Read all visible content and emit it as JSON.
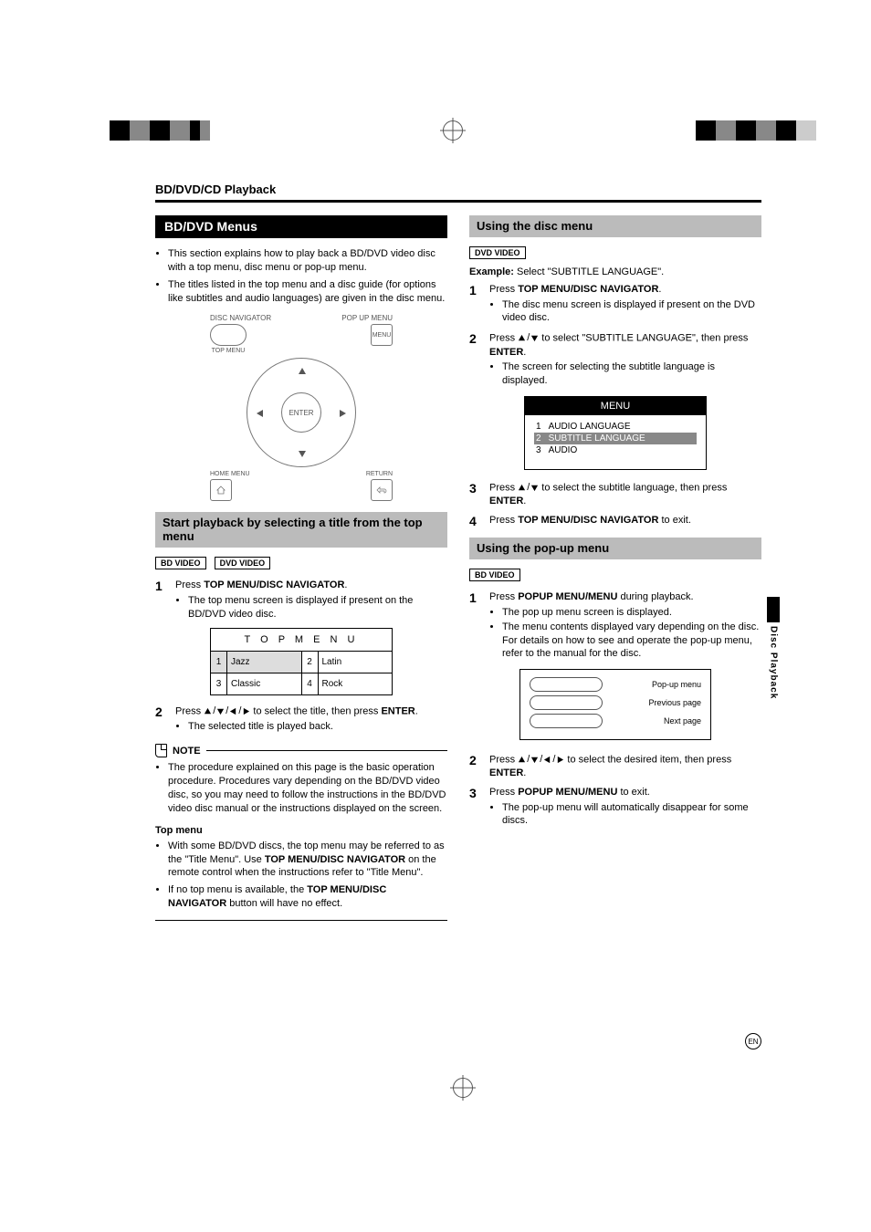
{
  "header": {
    "breadcrumb": "BD/DVD/CD Playback"
  },
  "left": {
    "section_title": "BD/DVD Menus",
    "intro_bullets": [
      "This section explains how to play back a BD/DVD video disc with a top menu, disc menu or pop-up menu.",
      "The titles listed in the top menu and a disc guide (for options like subtitles and audio languages) are given in the disc menu."
    ],
    "remote": {
      "disc_nav": "DISC NAVIGATOR",
      "popup_menu": "POP UP MENU",
      "top_menu": "TOP MENU",
      "menu": "MENU",
      "home_menu": "HOME MENU",
      "return": "RETURN",
      "enter": "ENTER"
    },
    "subhead": "Start playback by selecting a title from the top menu",
    "badges": [
      "BD VIDEO",
      "DVD VIDEO"
    ],
    "steps": [
      {
        "n": "1",
        "line": "Press ",
        "bold": "TOP MENU/DISC NAVIGATOR",
        "tail": ".",
        "sub": [
          "The top menu screen is displayed if present on the BD/DVD video disc."
        ]
      },
      {
        "n": "2",
        "prefix": "Press ",
        "mid": " to select the title, then press ",
        "bold": "ENTER",
        "tail": ".",
        "sub": [
          "The selected title is played back."
        ]
      }
    ],
    "top_menu": {
      "title": "T O P  M E N U",
      "rows": [
        {
          "n1": "1",
          "l1": "Jazz",
          "n2": "2",
          "l2": "Latin"
        },
        {
          "n1": "3",
          "l1": "Classic",
          "n2": "4",
          "l2": "Rock"
        }
      ]
    },
    "note": {
      "label": "NOTE",
      "bullets": [
        "The procedure explained on this page is the basic operation procedure. Procedures vary depending on the BD/DVD video disc, so you may need to follow the instructions in the BD/DVD video disc manual or the instructions displayed on the screen."
      ]
    },
    "top_menu_section": {
      "title": "Top menu",
      "bullets": [
        {
          "pre": "With some BD/DVD discs, the top menu may be referred to as the \"Title Menu\". Use ",
          "bold": "TOP MENU/DISC NAVIGATOR",
          "post": " on the remote control when the instructions refer to \"Title Menu\"."
        },
        {
          "pre": "If no top menu is available, the ",
          "bold": "TOP MENU/DISC NAVIGATOR",
          "post": " button will have no effect."
        }
      ]
    }
  },
  "right": {
    "disc_menu": {
      "title": "Using the disc menu",
      "badge": "DVD VIDEO",
      "example_label": "Example:",
      "example_text": " Select \"SUBTITLE LANGUAGE\".",
      "steps": [
        {
          "n": "1",
          "prefix": "Press ",
          "bold": "TOP MENU/DISC NAVIGATOR",
          "tail": ".",
          "sub": [
            "The disc menu screen is displayed if present on the DVD video disc."
          ]
        },
        {
          "n": "2",
          "prefix": "Press ",
          "mid": " to select \"SUBTITLE LANGUAGE\", then press ",
          "bold": "ENTER",
          "tail": ".",
          "sub": [
            "The screen for selecting the subtitle language is displayed."
          ]
        },
        {
          "n": "3",
          "prefix": "Press ",
          "mid": " to select the subtitle language, then press ",
          "bold": "ENTER",
          "tail": "."
        },
        {
          "n": "4",
          "prefix": "Press ",
          "bold": "TOP MENU/DISC NAVIGATOR",
          "tail": " to exit."
        }
      ],
      "menubox": {
        "title": "MENU",
        "rows": [
          {
            "n": "1",
            "label": "AUDIO LANGUAGE",
            "hl": false
          },
          {
            "n": "2",
            "label": "SUBTITLE LANGUAGE",
            "hl": true
          },
          {
            "n": "3",
            "label": "AUDIO",
            "hl": false
          }
        ]
      }
    },
    "popup": {
      "title": "Using the pop-up menu",
      "badge": "BD VIDEO",
      "steps": [
        {
          "n": "1",
          "prefix": "Press ",
          "bold": "POPUP MENU/MENU",
          "tail": " during playback.",
          "sub": [
            "The pop up menu screen is displayed.",
            "The menu contents displayed vary depending on the disc. For details on how to see and operate the pop-up menu, refer to the manual for the disc."
          ]
        },
        {
          "n": "2",
          "prefix": "Press ",
          "mid": " to select the desired item, then press ",
          "bold": "ENTER",
          "tail": "."
        },
        {
          "n": "3",
          "prefix": "Press ",
          "bold": "POPUP MENU/MENU",
          "tail": " to exit.",
          "sub": [
            "The pop-up menu will automatically disappear for some discs."
          ]
        }
      ],
      "box": {
        "rows": [
          "Pop-up menu",
          "Previous page",
          "Next page"
        ]
      }
    }
  },
  "side_tab": "Disc Playback",
  "page_marker": "EN"
}
